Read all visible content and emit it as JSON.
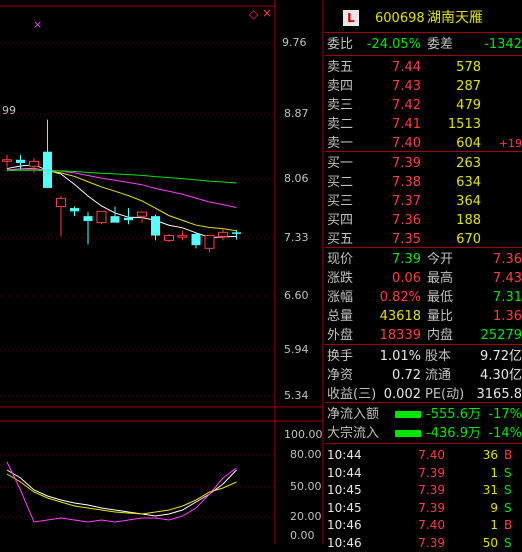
{
  "top_label": "99",
  "diamond_icon": "◇",
  "close_icon": "×",
  "price_axis": {
    "ticks": [
      "9.76",
      "8.87",
      "8.06",
      "7.33",
      "6.60",
      "5.94",
      "5.34"
    ]
  },
  "indicator_axis": {
    "ticks": [
      "100.00",
      "80.00",
      "50.00",
      "20.00",
      "0.00"
    ]
  },
  "header": {
    "badge": "L",
    "code": "600698",
    "name": "湖南天雁"
  },
  "wei": {
    "weibi_label": "委比",
    "weibi_value": "-24.05%",
    "weicha_label": "委差",
    "weicha_value": "-1342"
  },
  "sell": [
    {
      "label": "卖五",
      "price": "7.44",
      "vol": "578",
      "chg": ""
    },
    {
      "label": "卖四",
      "price": "7.43",
      "vol": "287",
      "chg": ""
    },
    {
      "label": "卖三",
      "price": "7.42",
      "vol": "479",
      "chg": ""
    },
    {
      "label": "卖二",
      "price": "7.41",
      "vol": "1513",
      "chg": ""
    },
    {
      "label": "卖一",
      "price": "7.40",
      "vol": "604",
      "chg": "+19"
    }
  ],
  "buy": [
    {
      "label": "买一",
      "price": "7.39",
      "vol": "263"
    },
    {
      "label": "买二",
      "price": "7.38",
      "vol": "634"
    },
    {
      "label": "买三",
      "price": "7.37",
      "vol": "364"
    },
    {
      "label": "买四",
      "price": "7.36",
      "vol": "188"
    },
    {
      "label": "买五",
      "price": "7.35",
      "vol": "670"
    }
  ],
  "quote": [
    {
      "l1": "现价",
      "v1": "7.39",
      "c1": "green",
      "l2": "今开",
      "v2": "7.36",
      "c2": "red"
    },
    {
      "l1": "涨跌",
      "v1": "0.06",
      "c1": "red",
      "l2": "最高",
      "v2": "7.43",
      "c2": "red"
    },
    {
      "l1": "涨幅",
      "v1": "0.82%",
      "c1": "red",
      "l2": "最低",
      "v2": "7.31",
      "c2": "green"
    },
    {
      "l1": "总量",
      "v1": "43618",
      "c1": "yellow",
      "l2": "量比",
      "v2": "1.36",
      "c2": "red"
    },
    {
      "l1": "外盘",
      "v1": "18339",
      "c1": "red",
      "l2": "内盘",
      "v2": "25279",
      "c2": "green"
    }
  ],
  "stats": [
    {
      "l1": "换手",
      "v1": "1.01%",
      "l2": "股本",
      "v2": "9.72亿"
    },
    {
      "l1": "净资",
      "v1": "0.72",
      "l2": "流通",
      "v2": "4.30亿"
    },
    {
      "l1": "收益(三)",
      "v1": "0.002",
      "l2": "PE(动)",
      "v2": "3165.8"
    }
  ],
  "flows": [
    {
      "label": "净流入额",
      "value": "-555.6万",
      "pct": "-17%"
    },
    {
      "label": "大宗流入",
      "value": "-436.9万",
      "pct": "-14%"
    }
  ],
  "trades": [
    {
      "time": "10:44",
      "price": "7.40",
      "pc": "red",
      "vol": "36",
      "bs": "B"
    },
    {
      "time": "10:44",
      "price": "7.39",
      "pc": "red",
      "vol": "1",
      "bs": "S"
    },
    {
      "time": "10:45",
      "price": "7.39",
      "pc": "red",
      "vol": "31",
      "bs": "S"
    },
    {
      "time": "10:45",
      "price": "7.39",
      "pc": "red",
      "vol": "9",
      "bs": "S"
    },
    {
      "time": "10:46",
      "price": "7.40",
      "pc": "red",
      "vol": "1",
      "bs": "B"
    },
    {
      "time": "10:46",
      "price": "7.39",
      "pc": "red",
      "vol": "50",
      "bs": "S"
    }
  ],
  "colors": {
    "up": "#ff3c3c",
    "down": "#54ffff",
    "ma5": "#ffffff",
    "ma10": "#e6e600",
    "ma20": "#ff3cff",
    "ma60": "#00e600",
    "grid": "#a00000"
  },
  "chart_data": {
    "type": "candlestick",
    "candles": [
      {
        "o": 8.3,
        "h": 8.36,
        "l": 8.2,
        "c": 8.3
      },
      {
        "o": 8.3,
        "h": 8.36,
        "l": 8.18,
        "c": 8.26
      },
      {
        "o": 8.22,
        "h": 8.32,
        "l": 8.14,
        "c": 8.28
      },
      {
        "o": 8.4,
        "h": 8.8,
        "l": 7.95,
        "c": 7.95
      },
      {
        "o": 7.72,
        "h": 7.85,
        "l": 7.35,
        "c": 7.82
      },
      {
        "o": 7.7,
        "h": 7.72,
        "l": 7.6,
        "c": 7.66
      },
      {
        "o": 7.6,
        "h": 7.65,
        "l": 7.25,
        "c": 7.54
      },
      {
        "o": 7.52,
        "h": 7.66,
        "l": 7.5,
        "c": 7.66
      },
      {
        "o": 7.6,
        "h": 7.72,
        "l": 7.55,
        "c": 7.52
      },
      {
        "o": 7.58,
        "h": 7.7,
        "l": 7.5,
        "c": 7.55
      },
      {
        "o": 7.6,
        "h": 7.66,
        "l": 7.52,
        "c": 7.65
      },
      {
        "o": 7.6,
        "h": 7.62,
        "l": 7.3,
        "c": 7.36
      },
      {
        "o": 7.3,
        "h": 7.38,
        "l": 7.28,
        "c": 7.36
      },
      {
        "o": 7.34,
        "h": 7.42,
        "l": 7.3,
        "c": 7.36
      },
      {
        "o": 7.38,
        "h": 7.4,
        "l": 7.2,
        "c": 7.24
      },
      {
        "o": 7.2,
        "h": 7.36,
        "l": 7.15,
        "c": 7.36
      },
      {
        "o": 7.35,
        "h": 7.45,
        "l": 7.3,
        "c": 7.4
      },
      {
        "o": 7.4,
        "h": 7.43,
        "l": 7.31,
        "c": 7.39
      }
    ]
  }
}
